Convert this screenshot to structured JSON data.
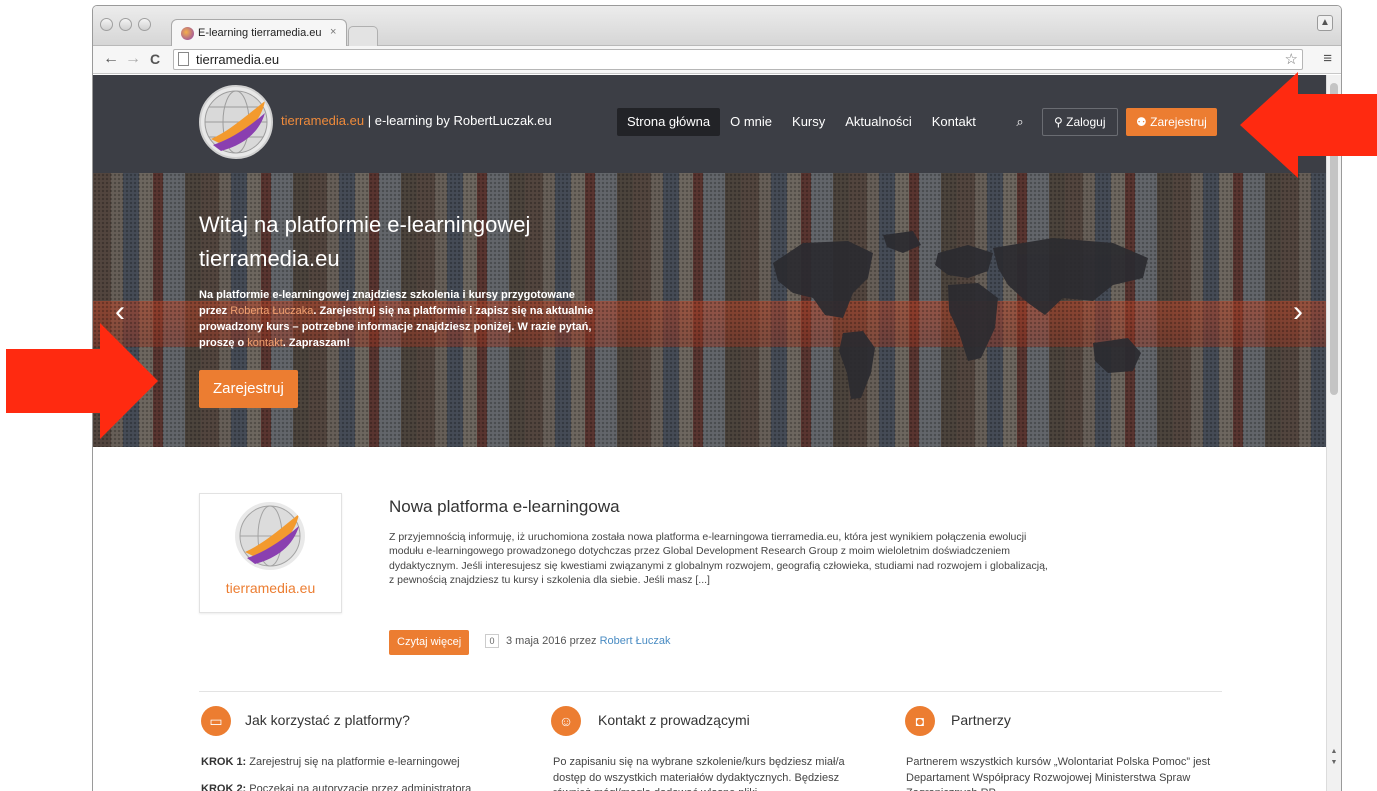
{
  "browser": {
    "tab_title": "E-learning tierramedia.eu",
    "tab_close": "×",
    "url": "tierramedia.eu",
    "profile_glyph": "▲",
    "menu_glyph": "≡",
    "back_glyph": "←",
    "forward_glyph": "→",
    "reload_glyph": "C",
    "star_glyph": "☆"
  },
  "header": {
    "brand_highlight": "tierramedia.eu",
    "brand_rest": " | e-learning by RobertLuczak.eu",
    "nav": [
      {
        "label": "Strona główna"
      },
      {
        "label": "O mnie"
      },
      {
        "label": "Kursy"
      },
      {
        "label": "Aktualności"
      },
      {
        "label": "Kontakt"
      }
    ],
    "search_glyph": "⌕",
    "login_label": "Zaloguj",
    "login_glyph": "⚲",
    "register_label": "Zarejestruj",
    "register_glyph": "⚉"
  },
  "hero": {
    "title": "Witaj na platformie e-learningowej tierramedia.eu",
    "text_1": "Na platformie e-learningowej znajdziesz szkolenia i kursy przygotowane przez ",
    "text_link_1": "Roberta Łuczaka",
    "text_2": ". Zarejestruj się na platformie i zapisz się na aktualnie prowadzony kurs – potrzebne informacje znajdziesz poniżej. W razie pytań, proszę o ",
    "text_link_2": "kontakt",
    "text_3": ". Zapraszam!",
    "cta_label": "Zarejestruj",
    "prev_glyph": "‹",
    "next_glyph": "›"
  },
  "post": {
    "thumb_text": "tierramedia.eu",
    "title": "Nowa platforma e-learningowa",
    "excerpt": "Z przyjemnością informuję, iż uruchomiona została nowa platforma e-learningowa tierramedia.eu, która jest wynikiem połączenia ewolucji modułu e-learningowego prowadzonego dotychczas przez Global Development Research Group z moim wieloletnim doświadczeniem dydaktycznym. Jeśli interesujesz się kwestiami związanymi z globalnym rozwojem, geografią człowieka, studiami nad rozwojem i globalizacją, z pewnością znajdziesz tu kursy i szkolenia dla siebie. Jeśli masz [...]",
    "read_more": "Czytaj więcej",
    "comments": "0",
    "date": "3 maja 2016 przez ",
    "author": "Robert Łuczak"
  },
  "features": [
    {
      "icon_glyph": "▭",
      "title": "Jak korzystać z platformy?",
      "step1_label": "KROK 1:",
      "step1_text": " Zarejestruj się na platformie e-learningowej",
      "step2_label": "KROK 2:",
      "step2_text": " Poczekaj na autoryzację przez administratora"
    },
    {
      "icon_glyph": "☺",
      "title": "Kontakt z prowadzącymi",
      "text": "Po zapisaniu się na wybrane szkolenie/kurs będziesz miał/a dostęp do wszystkich materiałów dydaktycznych. Będziesz również mógł/mogła dodawać własne pliki"
    },
    {
      "icon_glyph": "◘",
      "title": "Partnerzy",
      "text": "Partnerem wszystkich kursów „Wolontariat Polska Pomoc” jest Departament Współpracy Rozwojowej Ministerstwa Spraw Zagranicznych RP"
    }
  ],
  "colors": {
    "accent": "#ec7d31",
    "header_bg": "#3c3e45",
    "annotation": "#ff2a10"
  }
}
